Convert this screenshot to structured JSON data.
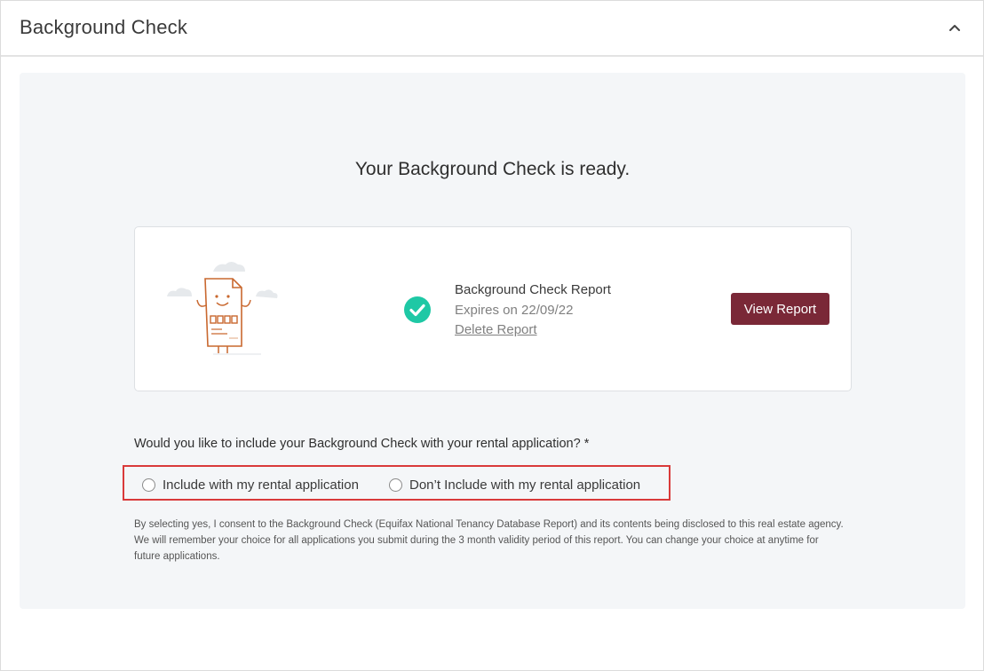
{
  "panel": {
    "title": "Background Check",
    "collapse_icon": "chevron-up-icon"
  },
  "main": {
    "ready_title": "Your Background Check is ready."
  },
  "report": {
    "illustration": "document-character-illustration",
    "status_icon": "check-circle-icon",
    "status_color": "#1ec8a5",
    "name": "Background Check Report",
    "expires": "Expires on 22/09/22",
    "delete_label": "Delete Report",
    "view_label": "View Report",
    "view_button_color": "#7a2837"
  },
  "consent": {
    "question": "Would you like to include your Background Check with your rental application? *",
    "options": [
      {
        "label": "Include with my rental application",
        "selected": false
      },
      {
        "label": "Don’t Include with my rental application",
        "selected": false
      }
    ],
    "highlight_color": "#d93a3a",
    "disclaimer": "By selecting yes, I consent to the Background Check (Equifax National Tenancy Database Report) and its contents being disclosed to this real estate agency. We will remember your choice for all applications you submit during the 3 month validity period of this report. You can change your choice at anytime for future applications."
  }
}
